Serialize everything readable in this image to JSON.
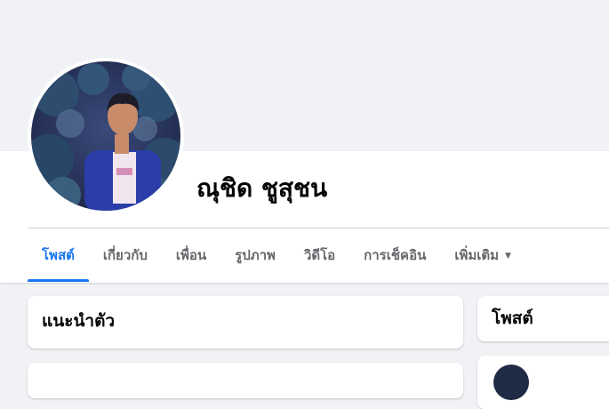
{
  "profile": {
    "name": "ณุชิด ชูสุชน",
    "avatar_icon": "profile-photo"
  },
  "tabs": [
    {
      "label": "โพสต์",
      "active": true
    },
    {
      "label": "เกี่ยวกับ",
      "active": false
    },
    {
      "label": "เพื่อน",
      "active": false
    },
    {
      "label": "รูปภาพ",
      "active": false
    },
    {
      "label": "วิดีโอ",
      "active": false
    },
    {
      "label": "การเช็คอิน",
      "active": false
    },
    {
      "label": "เพิ่มเติม",
      "active": false,
      "icon": "caret-down-icon"
    }
  ],
  "intro_card": {
    "title": "แนะนำตัว"
  },
  "posts_card": {
    "title": "โพสต์"
  },
  "colors": {
    "accent": "#1877f2",
    "background": "#f0f2f5",
    "card": "#ffffff",
    "muted_text": "#65676b"
  }
}
